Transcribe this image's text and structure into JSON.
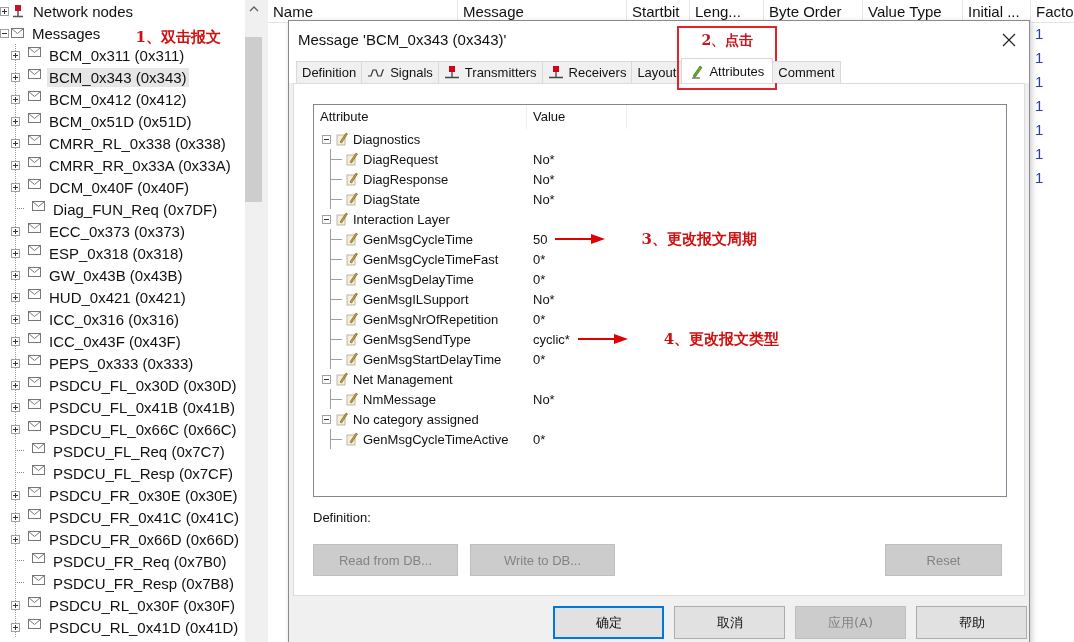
{
  "tree": [
    {
      "label": "Network nodes",
      "kind": "nodes",
      "expanded": false
    },
    {
      "label": "Messages",
      "kind": "messages",
      "expanded": true,
      "annotation": "1、双击报文",
      "children": [
        {
          "label": "BCM_0x311 (0x311)",
          "has_children": true,
          "selected": false
        },
        {
          "label": "BCM_0x343 (0x343)",
          "has_children": true,
          "selected": true
        },
        {
          "label": "BCM_0x412 (0x412)",
          "has_children": true,
          "selected": false
        },
        {
          "label": "BCM_0x51D (0x51D)",
          "has_children": true,
          "selected": false
        },
        {
          "label": "CMRR_RL_0x338 (0x338)",
          "has_children": true,
          "selected": false
        },
        {
          "label": "CMRR_RR_0x33A (0x33A)",
          "has_children": true,
          "selected": false
        },
        {
          "label": "DCM_0x40F (0x40F)",
          "has_children": true,
          "selected": false
        },
        {
          "label": "Diag_FUN_Req (0x7DF)",
          "has_children": false,
          "selected": false
        },
        {
          "label": "ECC_0x373 (0x373)",
          "has_children": true,
          "selected": false
        },
        {
          "label": "ESP_0x318 (0x318)",
          "has_children": true,
          "selected": false
        },
        {
          "label": "GW_0x43B (0x43B)",
          "has_children": true,
          "selected": false
        },
        {
          "label": "HUD_0x421 (0x421)",
          "has_children": true,
          "selected": false
        },
        {
          "label": "ICC_0x316 (0x316)",
          "has_children": true,
          "selected": false
        },
        {
          "label": "ICC_0x43F (0x43F)",
          "has_children": true,
          "selected": false
        },
        {
          "label": "PEPS_0x333 (0x333)",
          "has_children": true,
          "selected": false
        },
        {
          "label": "PSDCU_FL_0x30D (0x30D)",
          "has_children": true,
          "selected": false
        },
        {
          "label": "PSDCU_FL_0x41B (0x41B)",
          "has_children": true,
          "selected": false
        },
        {
          "label": "PSDCU_FL_0x66C (0x66C)",
          "has_children": true,
          "selected": false
        },
        {
          "label": "PSDCU_FL_Req (0x7C7)",
          "has_children": false,
          "selected": false
        },
        {
          "label": "PSDCU_FL_Resp (0x7CF)",
          "has_children": false,
          "selected": false
        },
        {
          "label": "PSDCU_FR_0x30E (0x30E)",
          "has_children": true,
          "selected": false
        },
        {
          "label": "PSDCU_FR_0x41C (0x41C)",
          "has_children": true,
          "selected": false
        },
        {
          "label": "PSDCU_FR_0x66D (0x66D)",
          "has_children": true,
          "selected": false
        },
        {
          "label": "PSDCU_FR_Req (0x7B0)",
          "has_children": false,
          "selected": false
        },
        {
          "label": "PSDCU_FR_Resp (0x7B8)",
          "has_children": false,
          "selected": false
        },
        {
          "label": "PSDCU_RL_0x30F (0x30F)",
          "has_children": true,
          "selected": false
        },
        {
          "label": "PSDCU_RL_0x41D (0x41D)",
          "has_children": true,
          "selected": false
        }
      ]
    }
  ],
  "table": {
    "columns": [
      "Name",
      "Message",
      "Startbit",
      "Leng...",
      "Byte Order",
      "Value Type",
      "Initial ...",
      "Facto"
    ],
    "last_column_cells": [
      "1",
      "1",
      "1",
      "1",
      "1",
      "1",
      "1"
    ]
  },
  "dialog": {
    "title": "Message 'BCM_0x343 (0x343)'",
    "tabs": [
      {
        "label": "Definition",
        "kind": "plain",
        "selected": false
      },
      {
        "label": "Signals",
        "kind": "wave",
        "selected": false
      },
      {
        "label": "Transmitters",
        "kind": "node",
        "selected": false
      },
      {
        "label": "Receivers",
        "kind": "node",
        "selected": false
      },
      {
        "label": "Layout",
        "kind": "plain",
        "selected": false
      },
      {
        "label": "Attributes",
        "kind": "pencil",
        "selected": true,
        "annotation": "2、点击"
      },
      {
        "label": "Comment",
        "kind": "plain",
        "selected": false
      }
    ],
    "attribute_tree": {
      "columns": [
        "Attribute",
        "Value"
      ],
      "groups": [
        {
          "name": "Diagnostics",
          "expanded": true,
          "children": [
            {
              "name": "DiagRequest",
              "value": "No*"
            },
            {
              "name": "DiagResponse",
              "value": "No*"
            },
            {
              "name": "DiagState",
              "value": "No*"
            }
          ]
        },
        {
          "name": "Interaction Layer",
          "expanded": true,
          "children": [
            {
              "name": "GenMsgCycleTime",
              "value": "50",
              "annotation": "3、更改报文周期"
            },
            {
              "name": "GenMsgCycleTimeFast",
              "value": "0*"
            },
            {
              "name": "GenMsgDelayTime",
              "value": "0*"
            },
            {
              "name": "GenMsgILSupport",
              "value": "No*"
            },
            {
              "name": "GenMsgNrOfRepetition",
              "value": "0*"
            },
            {
              "name": "GenMsgSendType",
              "value": "cyclic*",
              "annotation": "4、更改报文类型"
            },
            {
              "name": "GenMsgStartDelayTime",
              "value": "0*"
            }
          ]
        },
        {
          "name": "Net Management",
          "expanded": true,
          "children": [
            {
              "name": "NmMessage",
              "value": "No*"
            }
          ]
        },
        {
          "name": "No category assigned",
          "expanded": true,
          "children": [
            {
              "name": "GenMsgCycleTimeActive",
              "value": "0*"
            }
          ]
        }
      ]
    },
    "definition_label": "Definition:",
    "panel_buttons": [
      {
        "label": "Read from DB...",
        "disabled": true
      },
      {
        "label": "Write to DB...",
        "disabled": true
      },
      {
        "label": "Reset",
        "disabled": true
      }
    ],
    "footer_buttons": [
      {
        "label": "确定",
        "disabled": false,
        "default": true
      },
      {
        "label": "取消",
        "disabled": false,
        "default": false
      },
      {
        "label": "应用(A)",
        "disabled": true,
        "default": false
      },
      {
        "label": "帮助",
        "disabled": false,
        "default": false
      }
    ]
  }
}
